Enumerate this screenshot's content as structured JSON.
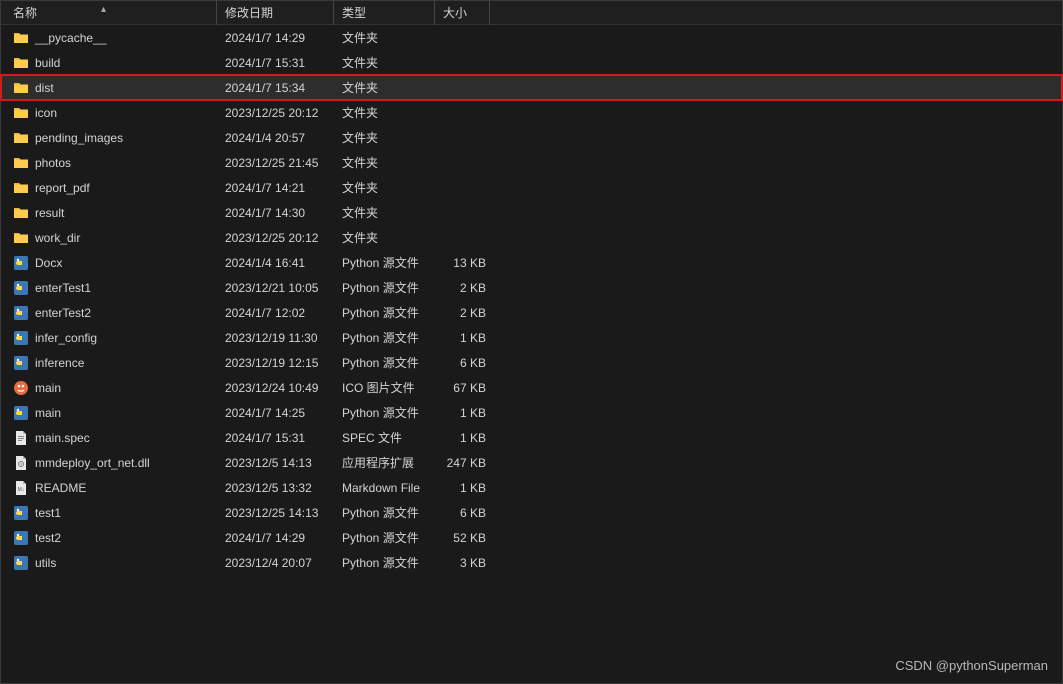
{
  "columns": {
    "name": "名称",
    "date": "修改日期",
    "type": "类型",
    "size": "大小"
  },
  "watermark": "CSDN @pythonSuperman",
  "icons": {
    "folder": "folder",
    "py": "py",
    "ico": "ico",
    "spec": "spec",
    "dll": "dll",
    "md": "md"
  },
  "rows": [
    {
      "name": "__pycache__",
      "date": "2024/1/7 14:29",
      "type": "文件夹",
      "size": "",
      "icon": "folder",
      "highlight": false
    },
    {
      "name": "build",
      "date": "2024/1/7 15:31",
      "type": "文件夹",
      "size": "",
      "icon": "folder",
      "highlight": false
    },
    {
      "name": "dist",
      "date": "2024/1/7 15:34",
      "type": "文件夹",
      "size": "",
      "icon": "folder",
      "highlight": true
    },
    {
      "name": "icon",
      "date": "2023/12/25 20:12",
      "type": "文件夹",
      "size": "",
      "icon": "folder",
      "highlight": false
    },
    {
      "name": "pending_images",
      "date": "2024/1/4 20:57",
      "type": "文件夹",
      "size": "",
      "icon": "folder",
      "highlight": false
    },
    {
      "name": "photos",
      "date": "2023/12/25 21:45",
      "type": "文件夹",
      "size": "",
      "icon": "folder",
      "highlight": false
    },
    {
      "name": "report_pdf",
      "date": "2024/1/7 14:21",
      "type": "文件夹",
      "size": "",
      "icon": "folder",
      "highlight": false
    },
    {
      "name": "result",
      "date": "2024/1/7 14:30",
      "type": "文件夹",
      "size": "",
      "icon": "folder",
      "highlight": false
    },
    {
      "name": "work_dir",
      "date": "2023/12/25 20:12",
      "type": "文件夹",
      "size": "",
      "icon": "folder",
      "highlight": false
    },
    {
      "name": "Docx",
      "date": "2024/1/4 16:41",
      "type": "Python 源文件",
      "size": "13 KB",
      "icon": "py",
      "highlight": false
    },
    {
      "name": "enterTest1",
      "date": "2023/12/21 10:05",
      "type": "Python 源文件",
      "size": "2 KB",
      "icon": "py",
      "highlight": false
    },
    {
      "name": "enterTest2",
      "date": "2024/1/7 12:02",
      "type": "Python 源文件",
      "size": "2 KB",
      "icon": "py",
      "highlight": false
    },
    {
      "name": "infer_config",
      "date": "2023/12/19 11:30",
      "type": "Python 源文件",
      "size": "1 KB",
      "icon": "py",
      "highlight": false
    },
    {
      "name": "inference",
      "date": "2023/12/19 12:15",
      "type": "Python 源文件",
      "size": "6 KB",
      "icon": "py",
      "highlight": false
    },
    {
      "name": "main",
      "date": "2023/12/24 10:49",
      "type": "ICO 图片文件",
      "size": "67 KB",
      "icon": "ico",
      "highlight": false
    },
    {
      "name": "main",
      "date": "2024/1/7 14:25",
      "type": "Python 源文件",
      "size": "1 KB",
      "icon": "py",
      "highlight": false
    },
    {
      "name": "main.spec",
      "date": "2024/1/7 15:31",
      "type": "SPEC 文件",
      "size": "1 KB",
      "icon": "spec",
      "highlight": false
    },
    {
      "name": "mmdeploy_ort_net.dll",
      "date": "2023/12/5 14:13",
      "type": "应用程序扩展",
      "size": "247 KB",
      "icon": "dll",
      "highlight": false
    },
    {
      "name": "README",
      "date": "2023/12/5 13:32",
      "type": "Markdown File",
      "size": "1 KB",
      "icon": "md",
      "highlight": false
    },
    {
      "name": "test1",
      "date": "2023/12/25 14:13",
      "type": "Python 源文件",
      "size": "6 KB",
      "icon": "py",
      "highlight": false
    },
    {
      "name": "test2",
      "date": "2024/1/7 14:29",
      "type": "Python 源文件",
      "size": "52 KB",
      "icon": "py",
      "highlight": false
    },
    {
      "name": "utils",
      "date": "2023/12/4 20:07",
      "type": "Python 源文件",
      "size": "3 KB",
      "icon": "py",
      "highlight": false
    }
  ]
}
